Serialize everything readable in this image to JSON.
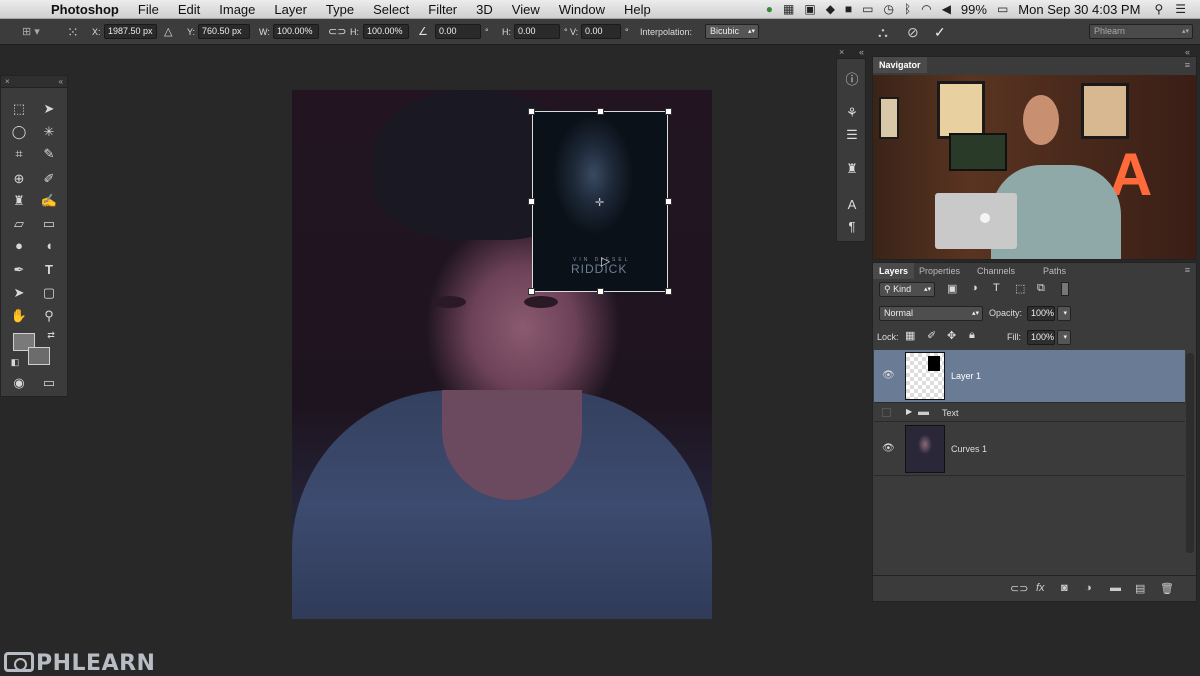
{
  "menubar": {
    "apple_icon": "apple-logo",
    "app_name": "Photoshop",
    "items": [
      "File",
      "Edit",
      "Image",
      "Layer",
      "Type",
      "Select",
      "Filter",
      "3D",
      "View",
      "Window",
      "Help"
    ],
    "battery": "99%",
    "clock": "Mon Sep 30  4:03 PM"
  },
  "options": {
    "x_label": "X:",
    "x_value": "1987.50 px",
    "y_label": "Y:",
    "y_value": "760.50 px",
    "w_label": "W:",
    "w_value": "100.00%",
    "h_label": "H:",
    "h_value": "100.00%",
    "angle_value": "0.00",
    "deg": "°",
    "hskew_label": "H:",
    "hskew_value": "0.00",
    "vskew_label": "V:",
    "vskew_value": "0.00",
    "interp_label": "Interpolation:",
    "interp_value": "Bicubic",
    "workspace": "Phlearn"
  },
  "canvas": {
    "poster_title": "RIDDICK",
    "poster_sub": "VIN DIESEL"
  },
  "navigator": {
    "tab": "Navigator"
  },
  "layers_panel": {
    "tabs": [
      "Layers",
      "Properties",
      "Channels",
      "Paths"
    ],
    "kind": "Kind",
    "blend_mode": "Normal",
    "opacity_label": "Opacity:",
    "opacity_value": "100%",
    "lock_label": "Lock:",
    "fill_label": "Fill:",
    "fill_value": "100%",
    "layers": [
      {
        "name": "Layer 1"
      },
      {
        "name": "Text"
      },
      {
        "name": "Curves 1"
      }
    ]
  },
  "branding": {
    "logo_text": "PHLEARN"
  },
  "colors": {
    "selected_layer": "#6a7b95",
    "panel_bg": "#3b3b3b",
    "app_bg": "#282828"
  }
}
